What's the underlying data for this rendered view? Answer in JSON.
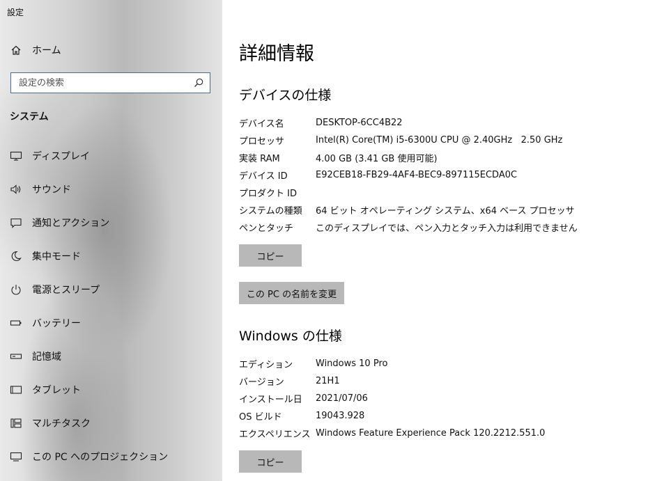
{
  "app": {
    "title": "設定"
  },
  "sidebar": {
    "home_label": "ホーム",
    "search_placeholder": "設定の検索",
    "section_label": "システム",
    "items": [
      {
        "label": "ディスプレイ",
        "icon": "display-icon"
      },
      {
        "label": "サウンド",
        "icon": "speaker-icon"
      },
      {
        "label": "通知とアクション",
        "icon": "notification-icon"
      },
      {
        "label": "集中モード",
        "icon": "moon-icon"
      },
      {
        "label": "電源とスリープ",
        "icon": "power-icon"
      },
      {
        "label": "バッテリー",
        "icon": "battery-icon"
      },
      {
        "label": "記憶域",
        "icon": "storage-icon"
      },
      {
        "label": "タブレット",
        "icon": "tablet-icon"
      },
      {
        "label": "マルチタスク",
        "icon": "multitask-icon"
      },
      {
        "label": "この PC へのプロジェクション",
        "icon": "projection-icon"
      }
    ]
  },
  "main": {
    "title": "詳細情報",
    "device_specs": {
      "heading": "デバイスの仕様",
      "rows": [
        {
          "key": "デバイス名",
          "value": "DESKTOP-6CC4B22"
        },
        {
          "key": "プロセッサ",
          "value": "Intel(R) Core(TM) i5-6300U CPU @ 2.40GHz   2.50 GHz"
        },
        {
          "key": "実装 RAM",
          "value": "4.00 GB (3.41 GB 使用可能)"
        },
        {
          "key": "デバイス ID",
          "value": "E92CEB18-FB29-4AF4-BEC9-897115ECDA0C"
        },
        {
          "key": "プロダクト ID",
          "value": ""
        },
        {
          "key": "システムの種類",
          "value": "64 ビット オペレーティング システム、x64 ベース プロセッサ"
        },
        {
          "key": "ペンとタッチ",
          "value": "このディスプレイでは、ペン入力とタッチ入力は利用できません"
        }
      ],
      "copy_button": "コピー",
      "rename_button": "この PC の名前を変更"
    },
    "windows_specs": {
      "heading": "Windows の仕様",
      "rows": [
        {
          "key": "エディション",
          "value": "Windows 10 Pro"
        },
        {
          "key": "バージョン",
          "value": "21H1"
        },
        {
          "key": "インストール日",
          "value": "2021/07/06"
        },
        {
          "key": "OS ビルド",
          "value": "19043.928"
        },
        {
          "key": "エクスペリエンス",
          "value": "Windows Feature Experience Pack 120.2212.551.0"
        }
      ],
      "copy_button": "コピー"
    }
  },
  "colors": {
    "button_bg": "#b8b8b8",
    "search_border": "#4a6e8a",
    "content_bg": "#ffffff"
  }
}
